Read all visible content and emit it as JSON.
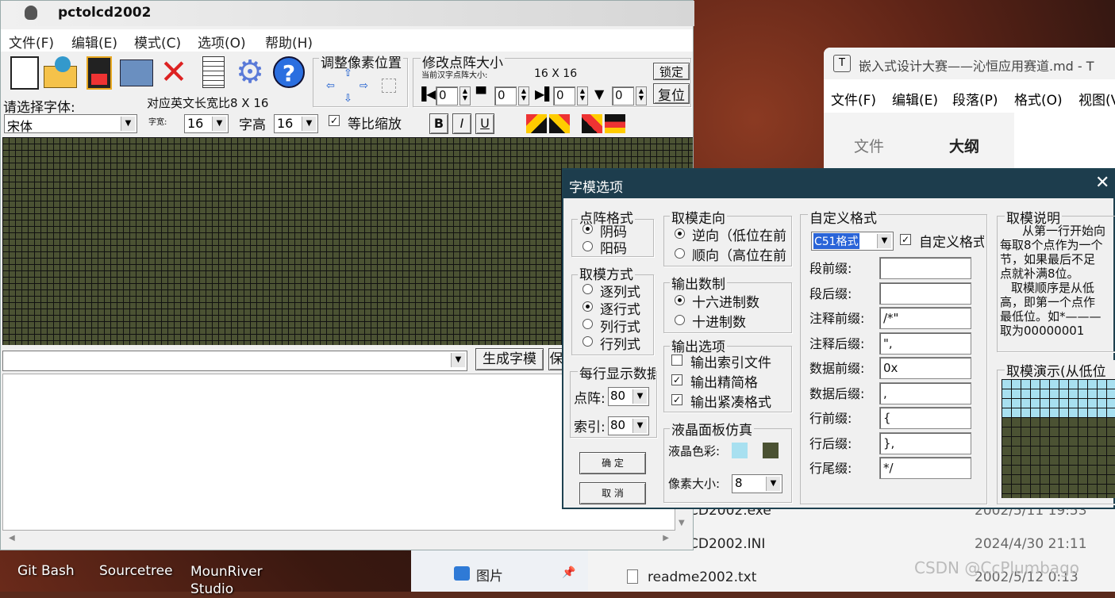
{
  "colors": {
    "lcd_bg": "#4b5233",
    "lcd_fg": "#a8e0f0",
    "dialog_title": "#1d3d4d"
  },
  "desktop": {
    "icons": [
      "Git Bash",
      "Sourcetree",
      "MounRiver Studio"
    ]
  },
  "explorer": {
    "sidebar_item": "图片",
    "files": [
      {
        "name": "CD2002.exe",
        "date": "2002/5/11 19:53"
      },
      {
        "name": "CD2002.INI",
        "date": "2024/4/30 21:11"
      },
      {
        "name": "readme2002.txt",
        "date": "2002/5/12 0:13"
      }
    ],
    "watermark": "CSDN @CcPlumbago"
  },
  "typora": {
    "title": "嵌入式设计大赛——沁恒应用赛道.md - T",
    "menus": [
      "文件(F)",
      "编辑(E)",
      "段落(P)",
      "格式(O)",
      "视图(V"
    ],
    "tabs": [
      "文件",
      "大纲"
    ]
  },
  "app": {
    "title": "pctolcd2002",
    "menus": [
      "文件(F)",
      "编辑(E)",
      "模式(C)",
      "选项(O)",
      "帮助(H)"
    ],
    "adjust_label": "调整像素位置",
    "resize_label": "修改点阵大小",
    "current_size_label": "当前汉字点阵大小:",
    "current_size": "16 X 16",
    "lock_btn": "锁定",
    "reset_btn": "复位",
    "spin_values": [
      "0",
      "0",
      "0",
      "0"
    ],
    "font_prompt": "请选择字体:",
    "font_value": "宋体",
    "ratio_label": "对应英文长宽比8 X 16",
    "width_label": "字宽:",
    "width_value": "16",
    "height_label": "字高",
    "height_value": "16",
    "scale_label": "等比缩放",
    "style_btns": [
      "B",
      "I",
      "U"
    ],
    "gen_btn": "生成字模",
    "save_btn": "保"
  },
  "dialog": {
    "title": "字模选项",
    "matrix_format": {
      "title": "点阵格式",
      "options": [
        "阴码",
        "阳码"
      ],
      "selected": 0
    },
    "take_mode": {
      "title": "取模方式",
      "options": [
        "逐列式",
        "逐行式",
        "列行式",
        "行列式"
      ],
      "selected": 1
    },
    "per_line": {
      "title": "每行显示数据",
      "dot_label": "点阵:",
      "dot_value": "80",
      "index_label": "索引:",
      "index_value": "80"
    },
    "ok_btn": "确 定",
    "cancel_btn": "取 消",
    "direction": {
      "title": "取模走向",
      "options": [
        "逆向（低位在前",
        "顺向（高位在前"
      ],
      "selected": 0
    },
    "output_base": {
      "title": "输出数制",
      "options": [
        "十六进制数",
        "十进制数"
      ],
      "selected": 0
    },
    "output_opts": {
      "title": "输出选项",
      "options": [
        {
          "label": "输出索引文件",
          "checked": false
        },
        {
          "label": "输出精简格",
          "checked": true
        },
        {
          "label": "输出紧凑格式",
          "checked": true
        }
      ]
    },
    "lcd_sim": {
      "title": "液晶面板仿真",
      "color_label": "液晶色彩:",
      "pixel_label": "像素大小:",
      "pixel_value": "8"
    },
    "custom": {
      "title": "自定义格式",
      "format_value": "C51格式",
      "custom_check": "自定义格式",
      "fields": [
        {
          "label": "段前缀:",
          "value": ""
        },
        {
          "label": "段后缀:",
          "value": ""
        },
        {
          "label": "注释前缀:",
          "value": "/*\""
        },
        {
          "label": "注释后缀:",
          "value": "\","
        },
        {
          "label": "数据前缀:",
          "value": "0x"
        },
        {
          "label": "数据后缀:",
          "value": ","
        },
        {
          "label": "行前缀:",
          "value": "{"
        },
        {
          "label": "行后缀:",
          "value": "},"
        },
        {
          "label": "行尾缀:",
          "value": "*/"
        }
      ]
    },
    "explain": {
      "title": "取模说明",
      "lines": [
        "从第一行开始向",
        "每取8个点作为一个",
        "节，如果最后不足",
        "点就补满8位。",
        "取模顺序是从低",
        "高，即第一个点作",
        "最低位。如*———",
        "取为00000001"
      ]
    },
    "demo_title": "取模演示(从低位"
  }
}
